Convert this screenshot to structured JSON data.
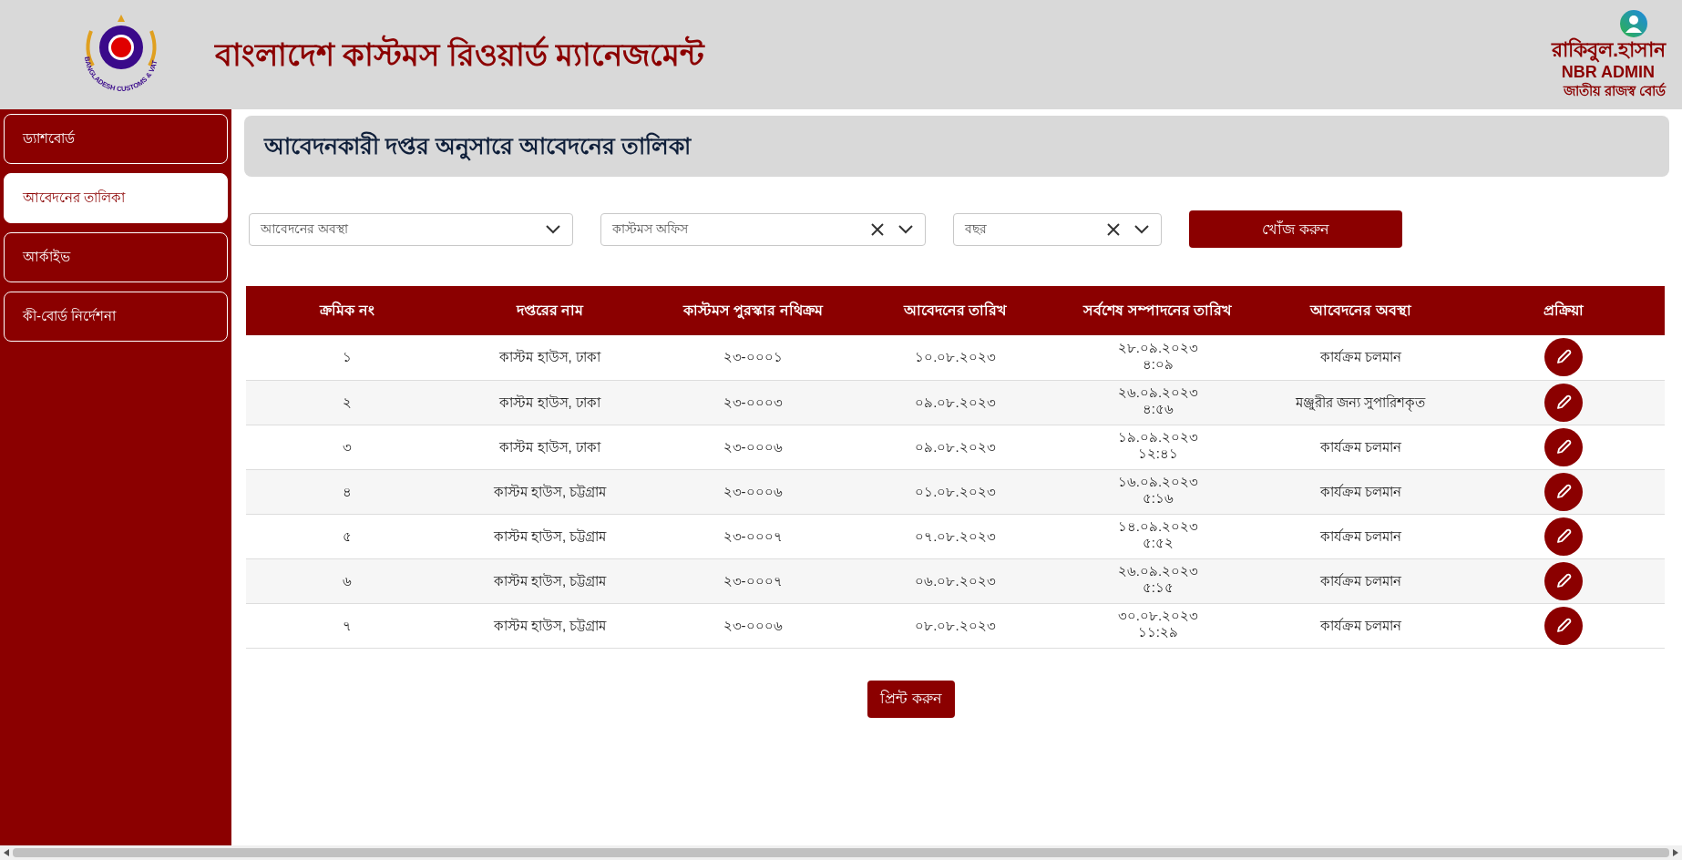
{
  "header": {
    "logo_text": "BANGLADESH CUSTOMS & VAT",
    "title": "বাংলাদেশ কাস্টমস রিওয়ার্ড ম্যানেজমেন্ট",
    "user": {
      "name": "রাকিবুল.হাসান",
      "role": "NBR ADMIN",
      "org": "জাতীয় রাজস্ব বোর্ড"
    }
  },
  "sidebar": {
    "items": [
      {
        "label": "ড্যাশবোর্ড",
        "selected": false
      },
      {
        "label": "আবেদনের তালিকা",
        "selected": true
      },
      {
        "label": "আর্কাইভ",
        "selected": false
      },
      {
        "label": "কী-বোর্ড নির্দেশনা",
        "selected": false
      }
    ]
  },
  "page_title": "আবেদনকারী দপ্তর অনুসারে আবেদনের তালিকা",
  "filters": [
    {
      "placeholder": "আবেদনের অবস্থা",
      "clearable": false
    },
    {
      "placeholder": "কাস্টমস অফিস",
      "clearable": true
    },
    {
      "placeholder": "বছর",
      "clearable": true
    }
  ],
  "search_button": "খোঁজ করুন",
  "table": {
    "columns": [
      "ক্রমিক নং",
      "দপ্তরের নাম",
      "কাস্টমস পুরস্কার নথিক্রম",
      "আবেদনের তারিখ",
      "সর্বশেষ সম্পাদনের তারিখ",
      "আবেদনের অবস্থা",
      "প্রক্রিয়া"
    ],
    "rows": [
      {
        "serial": "১",
        "office": "কাস্টম হাউস, ঢাকা",
        "file_no": "২৩-০০০১",
        "applied": "১০.০৮.২০২৩",
        "last_edited": "২৮.০৯.২০২৩\n৪:০৯",
        "status": "কার্যক্রম চলমান"
      },
      {
        "serial": "২",
        "office": "কাস্টম হাউস, ঢাকা",
        "file_no": "২৩-০০০৩",
        "applied": "০৯.০৮.২০২৩",
        "last_edited": "২৬.০৯.২০২৩\n৪:৫৬",
        "status": "মঞ্জুরীর জন্য সুপারিশকৃত"
      },
      {
        "serial": "৩",
        "office": "কাস্টম হাউস, ঢাকা",
        "file_no": "২৩-০০০৬",
        "applied": "০৯.০৮.২০২৩",
        "last_edited": "১৯.০৯.২০২৩\n১২:৪১",
        "status": "কার্যক্রম চলমান"
      },
      {
        "serial": "৪",
        "office": "কাস্টম হাউস, চট্টগ্রাম",
        "file_no": "২৩-০০০৬",
        "applied": "০১.০৮.২০২৩",
        "last_edited": "১৬.০৯.২০২৩\n৫:১৬",
        "status": "কার্যক্রম চলমান"
      },
      {
        "serial": "৫",
        "office": "কাস্টম হাউস, চট্টগ্রাম",
        "file_no": "২৩-০০০৭",
        "applied": "০৭.০৮.২০২৩",
        "last_edited": "১৪.০৯.২০২৩\n৫:৫২",
        "status": "কার্যক্রম চলমান"
      },
      {
        "serial": "৬",
        "office": "কাস্টম হাউস, চট্টগ্রাম",
        "file_no": "২৩-০০০৭",
        "applied": "০৬.০৮.২০২৩",
        "last_edited": "২৬.০৯.২০২৩\n৫:১৫",
        "status": "কার্যক্রম চলমান"
      },
      {
        "serial": "৭",
        "office": "কাস্টম হাউস, চট্টগ্রাম",
        "file_no": "২৩-০০০৬",
        "applied": "০৮.০৮.২০২৩",
        "last_edited": "৩০.০৮.২০২৩\n১১:২৯",
        "status": "কার্যক্রম চলমান"
      }
    ]
  },
  "print_button": "প্রিন্ট করুন"
}
